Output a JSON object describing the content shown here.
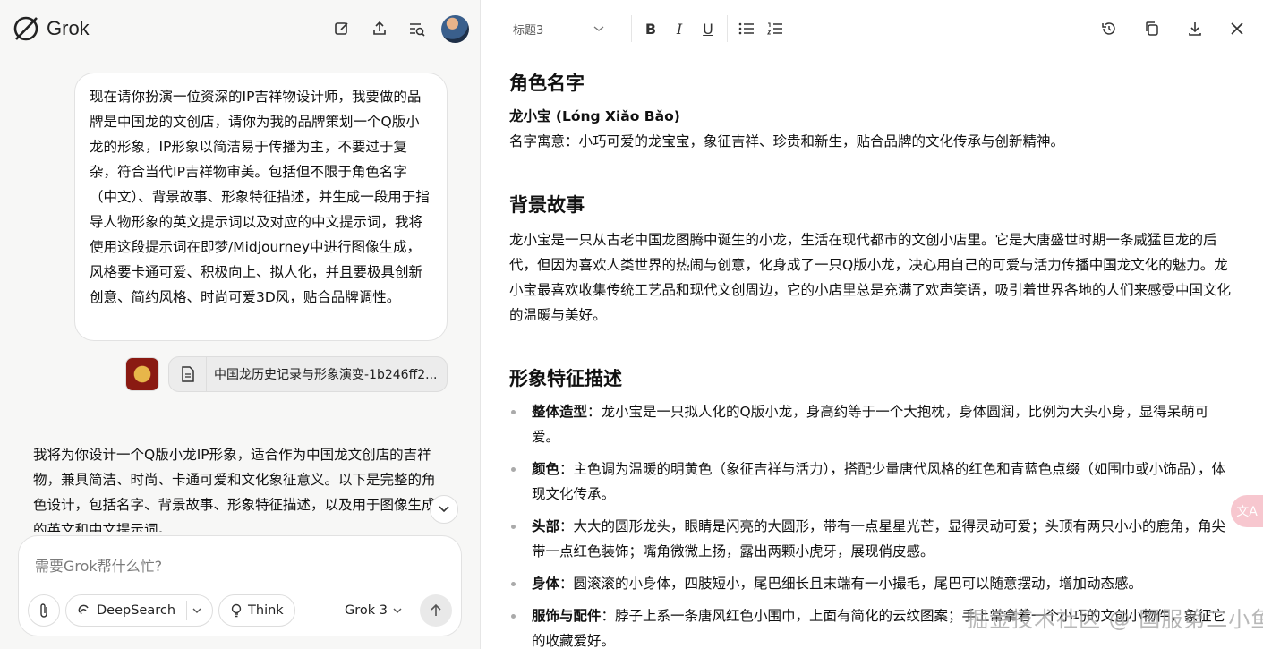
{
  "app": {
    "name": "Grok"
  },
  "chat": {
    "user_message": "现在请你扮演一位资深的IP吉祥物设计师，我要做的品牌是中国龙的文创店，请你为我的品牌策划一个Q版小龙的形象，IP形象以简洁易于传播为主，不要过于复杂，符合当代IP吉祥物审美。包括但不限于角色名字（中文）、背景故事、形象特征描述，并生成一段用于指导人物形象的英文提示词以及对应的中文提示词，我将使用这段提示词在即梦/Midjourney中进行图像生成，风格要卡通可爱、积极向上、拟人化，并且要极具创新创意、简约风格、时尚可爱3D风，贴合品牌调性。",
    "attachment_file": "中国龙历史记录与形象演变-1b246ff2...",
    "assistant_message": "我将为你设计一个Q版小龙IP形象，适合作为中国龙文创店的吉祥物，兼具简洁、时尚、卡通可爱和文化象征意义。以下是完整的角色设计，包括名字、背景故事、形象特征描述，以及用于图像生成的英文和中文提示词。",
    "composer_placeholder": "需要Grok帮什么忙?",
    "deepsearch_label": "DeepSearch",
    "think_label": "Think",
    "model_label": "Grok 3"
  },
  "doc": {
    "heading_select": "标题3",
    "sections": {
      "name_title": "角色名字",
      "name_value": "龙小宝 (Lóng Xiǎo Bǎo)",
      "name_meaning": "名字寓意：小巧可爱的龙宝宝，象征吉祥、珍贵和新生，贴合品牌的文化传承与创新精神。",
      "story_title": "背景故事",
      "story_text": "龙小宝是一只从古老中国龙图腾中诞生的小龙，生活在现代都市的文创小店里。它是大唐盛世时期一条威猛巨龙的后代，但因为喜欢人类世界的热闹与创意，化身成了一只Q版小龙，决心用自己的可爱与活力传播中国龙文化的魅力。龙小宝最喜欢收集传统工艺品和现代文创周边，它的小店里总是充满了欢声笑语，吸引着世界各地的人们来感受中国文化的温暖与美好。",
      "features_title": "形象特征描述",
      "features": [
        {
          "label": "整体造型",
          "text": "：龙小宝是一只拟人化的Q版小龙，身高约等于一个大抱枕，身体圆润，比例为大头小身，显得呆萌可爱。"
        },
        {
          "label": "颜色",
          "text": "：主色调为温暖的明黄色（象征吉祥与活力），搭配少量唐代风格的红色和青蓝色点缀（如围巾或小饰品），体现文化传承。"
        },
        {
          "label": "头部",
          "text": "：大大的圆形龙头，眼睛是闪亮的大圆形，带有一点星星光芒，显得灵动可爱；头顶有两只小小的鹿角，角尖带一点红色装饰；嘴角微微上扬，露出两颗小虎牙，展现俏皮感。"
        },
        {
          "label": "身体",
          "text": "：圆滚滚的小身体，四肢短小，尾巴细长且末端有一小撮毛，尾巴可以随意摆动，增加动态感。"
        },
        {
          "label": "服饰与配件",
          "text": "：脖子上系一条唐风红色小围巾，上面有简化的云纹图案；手上常拿着一个小巧的文创小物件，象征它的收藏爱好。"
        }
      ]
    },
    "translate_label": "文A",
    "watermark": "掘金技术社区 @ 国服第二小鱼王"
  }
}
